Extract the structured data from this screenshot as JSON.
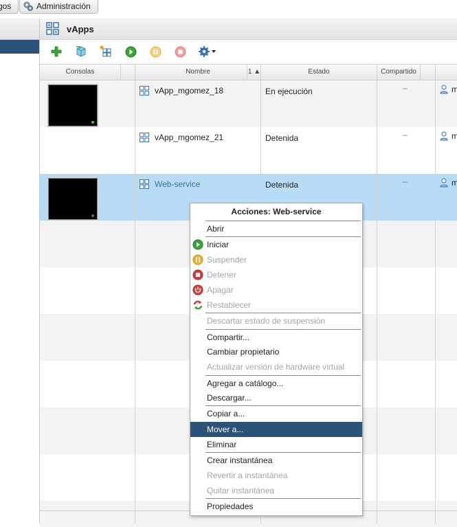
{
  "tabs": {
    "catalog_partial": "gos",
    "admin": "Administración"
  },
  "page": {
    "title": "vApps"
  },
  "columns": {
    "consoles": "Consolas",
    "name": "Nombre",
    "sort": "1 ▲",
    "status": "Estado",
    "shared": "Compartido"
  },
  "rows": [
    {
      "name": "vApp_mgomez_18",
      "status": "En ejecución",
      "shared": "–",
      "owner": "m"
    },
    {
      "name": "vApp_mgomez_21",
      "status": "Detenida",
      "shared": "–",
      "owner": "m"
    },
    {
      "name": "Web-service",
      "status": "Detenida",
      "shared": "–",
      "owner": "m"
    }
  ],
  "menu": {
    "title": "Acciones: Web-service",
    "items": [
      {
        "label": "Abrir"
      },
      {
        "label": "Iniciar"
      },
      {
        "label": "Suspender"
      },
      {
        "label": "Detener"
      },
      {
        "label": "Apagar"
      },
      {
        "label": "Restablecer"
      },
      {
        "label": "Descartar estado de suspensión"
      },
      {
        "label": "Compartir..."
      },
      {
        "label": "Cambiar propietario"
      },
      {
        "label": "Actualizar versión de hardware virtual"
      },
      {
        "label": "Agregar a catálogo..."
      },
      {
        "label": "Descargar..."
      },
      {
        "label": "Copiar a..."
      },
      {
        "label": "Mover a..."
      },
      {
        "label": "Eliminar"
      },
      {
        "label": "Crear instantánea"
      },
      {
        "label": "Revertir a instantánea"
      },
      {
        "label": "Quitar instantánea"
      },
      {
        "label": "Propiedades"
      }
    ]
  },
  "colors": {
    "selection": "#2d527a",
    "row_selected": "#b8dcf6"
  }
}
